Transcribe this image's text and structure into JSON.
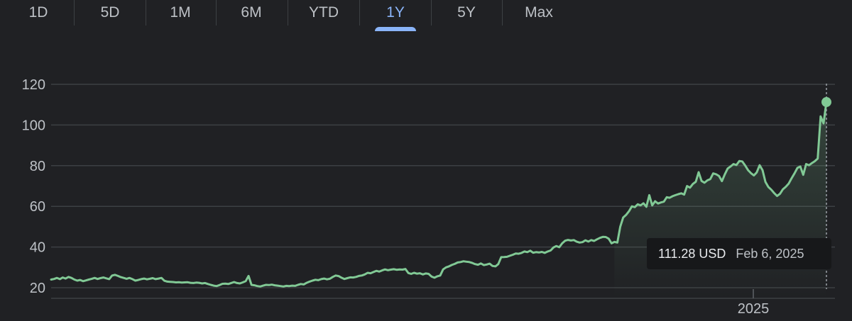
{
  "tabs": [
    {
      "label": "1D",
      "active": false
    },
    {
      "label": "5D",
      "active": false
    },
    {
      "label": "1M",
      "active": false
    },
    {
      "label": "6M",
      "active": false
    },
    {
      "label": "YTD",
      "active": false
    },
    {
      "label": "1Y",
      "active": true
    },
    {
      "label": "5Y",
      "active": false
    },
    {
      "label": "Max",
      "active": false
    }
  ],
  "tooltip": {
    "price": "111.28 USD",
    "date": "Feb 6, 2025"
  },
  "colors": {
    "line": "#81c995",
    "accent": "#8ab4f8",
    "grid": "#3c4043",
    "background": "#202124"
  },
  "chart_data": {
    "type": "line",
    "y_ticks": [
      20,
      40,
      60,
      80,
      100,
      120
    ],
    "x_tick_labels": [
      "2025"
    ],
    "ylim": [
      18,
      122
    ],
    "grid": "horizontal",
    "series": [
      {
        "values": [
          24,
          24.3,
          24.8,
          24.2,
          25,
          24.5,
          25.3,
          24.8,
          24,
          23.5,
          23.8,
          23.2,
          23.6,
          24,
          24.4,
          24.8,
          24.3,
          24.7,
          25,
          24.6,
          24.2,
          26,
          26.3,
          25.8,
          25.2,
          24.8,
          24.4,
          24.8,
          24.2,
          23.5,
          23.8,
          24.2,
          24.5,
          24.1,
          24.4,
          24.7,
          24.2,
          24.5,
          24.8,
          23.4,
          23,
          22.9,
          22.8,
          22.6,
          22.7,
          22.5,
          22.6,
          22.7,
          22.4,
          22.3,
          22.5,
          22.4,
          22.1,
          22.3,
          21.8,
          21.4,
          21,
          20.8,
          21.3,
          21.9,
          22,
          21.8,
          22.3,
          22.8,
          22.3,
          22.1,
          22.6,
          23.2,
          25.8,
          21.4,
          21.2,
          20.8,
          20.6,
          21,
          21.4,
          21.3,
          21.5,
          21.2,
          21,
          20.8,
          20.6,
          20.9,
          20.8,
          21,
          20.9,
          21.4,
          21.8,
          21.6,
          22.4,
          23,
          23.5,
          23.9,
          23.7,
          24.2,
          24.5,
          24.1,
          24.4,
          25.3,
          26,
          25.7,
          24.9,
          24.3,
          24.7,
          25.1,
          25,
          25.3,
          25.8,
          26,
          26.5,
          27.3,
          27.1,
          27.7,
          28.3,
          27.9,
          28.5,
          29,
          28.6,
          28.9,
          29.1,
          28.8,
          29,
          28.9,
          29.2,
          27.2,
          26.8,
          27.3,
          26.9,
          27.1,
          26.5,
          27,
          26.8,
          25.5,
          24.9,
          25.6,
          26,
          29,
          30,
          30.5,
          31.2,
          31.7,
          32.4,
          32.6,
          33,
          32.8,
          32.6,
          32.2,
          31.6,
          31.3,
          31.9,
          31.1,
          31.4,
          31.8,
          30.7,
          30.5,
          31.6,
          35,
          35.1,
          35.2,
          35.7,
          36.2,
          36.8,
          36.7,
          37.1,
          37.8,
          37.5,
          38.2,
          37.2,
          37.5,
          37.3,
          37.6,
          37.1,
          37.8,
          38.3,
          39.8,
          40.5,
          39.9,
          41.8,
          43.1,
          43.5,
          43.2,
          43.4,
          42.6,
          42.2,
          42.4,
          43.3,
          42.7,
          43.4,
          43,
          43.8,
          44.5,
          45,
          44.9,
          44.1,
          41.8,
          42.5,
          42.2,
          50,
          54.5,
          55.8,
          57.6,
          60,
          59.6,
          61,
          60.5,
          61.5,
          59.8,
          65.5,
          60.5,
          62.5,
          61.4,
          61.9,
          62.3,
          64.5,
          64.2,
          65,
          65.5,
          66,
          66.4,
          65.8,
          70,
          69.2,
          71,
          72.1,
          76.8,
          72.5,
          71.6,
          72.8,
          73.4,
          76.2,
          75.8,
          74.9,
          72.4,
          75.8,
          78.6,
          79.6,
          80.8,
          80.3,
          82.3,
          82.1,
          80.1,
          77.8,
          76.3,
          75.2,
          76.7,
          80.2,
          77.8,
          72,
          69.5,
          68.2,
          66.5,
          65.1,
          66.2,
          68.4,
          69.6,
          71.2,
          73.8,
          76.2,
          78.9,
          79.6,
          75.5,
          80.8,
          80.2,
          81.3,
          82.2,
          83.5,
          104.2,
          100.8,
          111.28
        ]
      }
    ]
  }
}
